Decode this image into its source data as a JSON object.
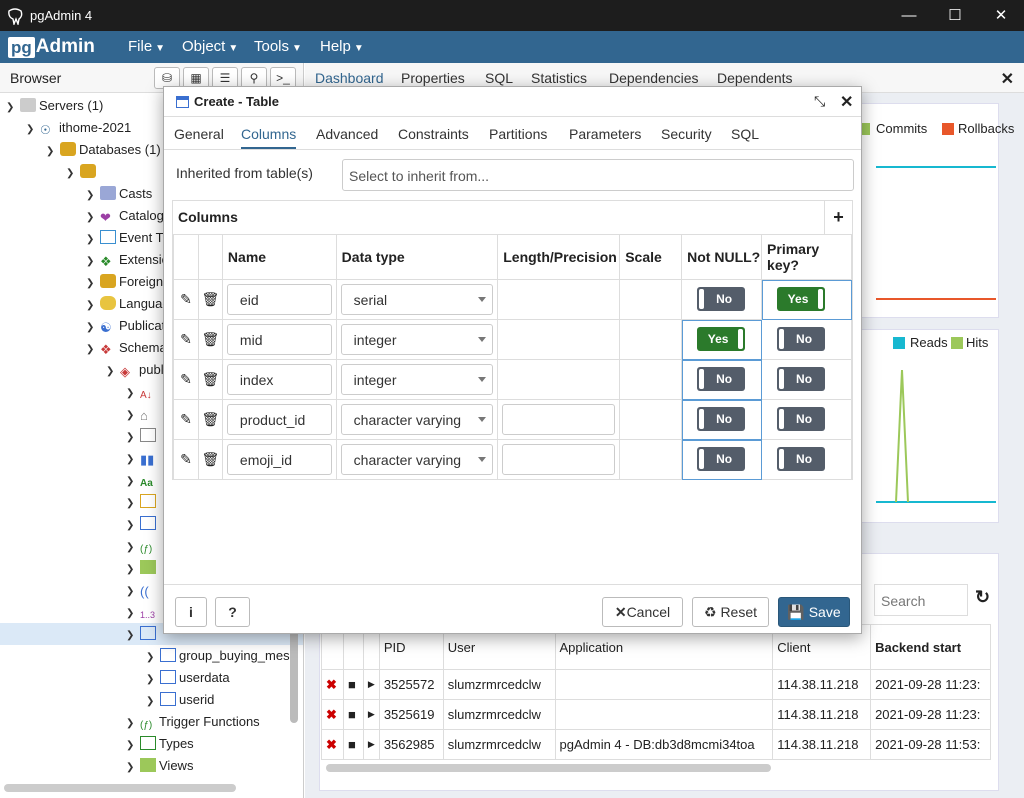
{
  "window": {
    "title": "pgAdmin 4"
  },
  "menu": {
    "logo_pg": "pg",
    "logo_admin": "Admin",
    "items": [
      {
        "label": "File"
      },
      {
        "label": "Object"
      },
      {
        "label": "Tools"
      },
      {
        "label": "Help"
      }
    ]
  },
  "browser": {
    "label": "Browser",
    "tree": [
      {
        "label": "Servers (1)"
      },
      {
        "label": "ithome-2021"
      },
      {
        "label": "Databases (1)"
      },
      {
        "label": ""
      },
      {
        "label": "Casts"
      },
      {
        "label": "Catalogs"
      },
      {
        "label": "Event Triggers"
      },
      {
        "label": "Extensions"
      },
      {
        "label": "Foreign Data Wrappers"
      },
      {
        "label": "Languages"
      },
      {
        "label": "Publications"
      },
      {
        "label": "Schemas"
      },
      {
        "label": "public"
      },
      {
        "label": "group_buying_mes"
      },
      {
        "label": "userdata"
      },
      {
        "label": "userid"
      },
      {
        "label": "Trigger Functions"
      },
      {
        "label": "Types"
      },
      {
        "label": "Views"
      },
      {
        "label": "1..3"
      },
      {
        "label": "Aa"
      }
    ]
  },
  "right_tabs": [
    {
      "label": "Dashboard"
    },
    {
      "label": "Properties"
    },
    {
      "label": "SQL"
    },
    {
      "label": "Statistics"
    },
    {
      "label": "Dependencies"
    },
    {
      "label": "Dependents"
    }
  ],
  "dashboard": {
    "legend_commits": "Commits",
    "legend_rollbacks": "Rollbacks",
    "legend_reads": "Reads",
    "legend_hits": "Hits",
    "search_placeholder": "Search",
    "sessions": {
      "headers": [
        "PID",
        "User",
        "Application",
        "Client",
        "Backend start"
      ],
      "rows": [
        [
          "3525572",
          "slumzrmrcedclw",
          "",
          "114.38.11.218",
          "2021-09-28 11:23:"
        ],
        [
          "3525619",
          "slumzrmrcedclw",
          "",
          "114.38.11.218",
          "2021-09-28 11:23:"
        ],
        [
          "3562985",
          "slumzrmrcedclw",
          "pgAdmin 4 - DB:db3d8mcmi34toa",
          "114.38.11.218",
          "2021-09-28 11:53:"
        ]
      ]
    }
  },
  "dialog": {
    "title": "Create - Table",
    "tabs": [
      {
        "label": "General"
      },
      {
        "label": "Columns"
      },
      {
        "label": "Advanced"
      },
      {
        "label": "Constraints"
      },
      {
        "label": "Partitions"
      },
      {
        "label": "Parameters"
      },
      {
        "label": "Security"
      },
      {
        "label": "SQL"
      }
    ],
    "inherit_label": "Inherited from table(s)",
    "inherit_placeholder": "Select to inherit from...",
    "columns_title": "Columns",
    "col_headers": [
      "Name",
      "Data type",
      "Length/Precision",
      "Scale",
      "Not NULL?",
      "Primary key?"
    ],
    "rows": [
      {
        "name": "eid",
        "type": "serial",
        "notnull": "No",
        "pk": "Yes"
      },
      {
        "name": "mid",
        "type": "integer",
        "notnull": "Yes",
        "pk": "No"
      },
      {
        "name": "index",
        "type": "integer",
        "notnull": "No",
        "pk": "No"
      },
      {
        "name": "product_id",
        "type": "character varying",
        "notnull": "No",
        "pk": "No"
      },
      {
        "name": "emoji_id",
        "type": "character varying",
        "notnull": "No",
        "pk": "No"
      }
    ],
    "buttons": {
      "info": "i",
      "help": "?",
      "cancel": "Cancel",
      "reset": "Reset",
      "save": "Save"
    }
  }
}
